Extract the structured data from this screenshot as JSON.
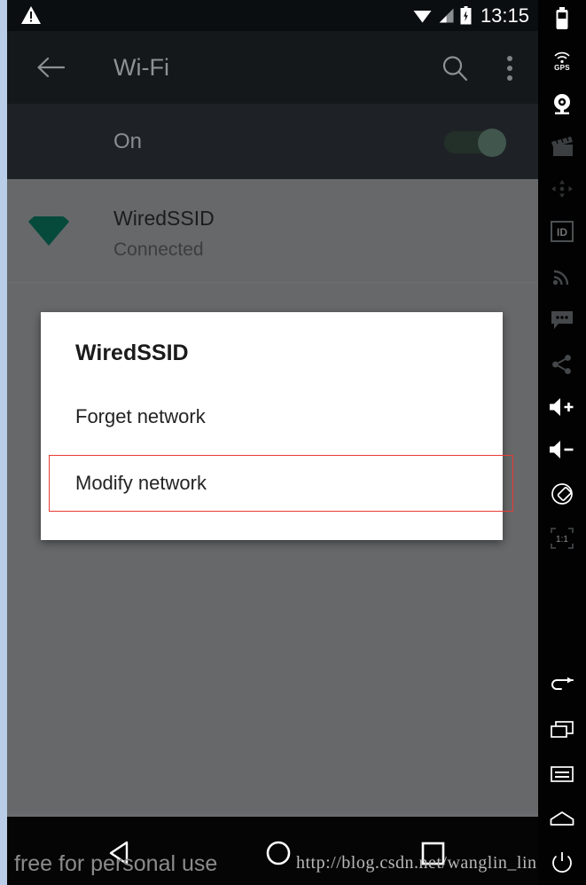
{
  "statusbar": {
    "warning_icon": "warning-triangle-icon",
    "wifi_icon": "wifi-signal-icon",
    "cellular_icon": "cellular-signal-icon",
    "battery_icon": "battery-charging-icon",
    "time": "13:15"
  },
  "appbar": {
    "back_icon": "arrow-left-icon",
    "title": "Wi-Fi",
    "search_icon": "search-icon",
    "overflow_icon": "overflow-menu-icon"
  },
  "wifi_toggle": {
    "label": "On",
    "state": "on",
    "track_color": "#233029",
    "thumb_color": "#41574e"
  },
  "networks": [
    {
      "icon": "wifi-connected-icon",
      "icon_color": "#064a3c",
      "ssid": "WiredSSID",
      "status": "Connected"
    }
  ],
  "dialog": {
    "title": "WiredSSID",
    "items": [
      {
        "label": "Forget network",
        "highlighted": false
      },
      {
        "label": "Modify network",
        "highlighted": true
      }
    ],
    "highlight_color": "#e83b32"
  },
  "navbar": {
    "back_icon": "nav-back-triangle-icon",
    "home_icon": "nav-home-circle-icon",
    "recents_icon": "nav-recents-square-icon"
  },
  "watermarks": {
    "left": "free for personal use",
    "right": "http://blog.csdn.net/wanglin_lin"
  },
  "emulator_toolbar": {
    "items": [
      {
        "name": "battery-icon",
        "label": ""
      },
      {
        "name": "gps-icon",
        "label": "GPS"
      },
      {
        "name": "webcam-icon",
        "label": ""
      },
      {
        "name": "clapperboard-icon",
        "label": ""
      },
      {
        "name": "dpad-icon",
        "label": ""
      },
      {
        "name": "id-icon",
        "label": "ID"
      },
      {
        "name": "cellular-icon",
        "label": ""
      },
      {
        "name": "sms-icon",
        "label": ""
      },
      {
        "name": "share-icon",
        "label": ""
      },
      {
        "name": "volume-up-icon",
        "label": ""
      },
      {
        "name": "volume-down-icon",
        "label": ""
      },
      {
        "name": "rotate-icon",
        "label": ""
      },
      {
        "name": "zoom-actual-icon",
        "label": "1:1"
      },
      {
        "name": "back-icon",
        "label": ""
      },
      {
        "name": "overview-icon",
        "label": ""
      },
      {
        "name": "menu-icon",
        "label": ""
      },
      {
        "name": "home-icon",
        "label": ""
      },
      {
        "name": "power-icon",
        "label": ""
      }
    ]
  }
}
